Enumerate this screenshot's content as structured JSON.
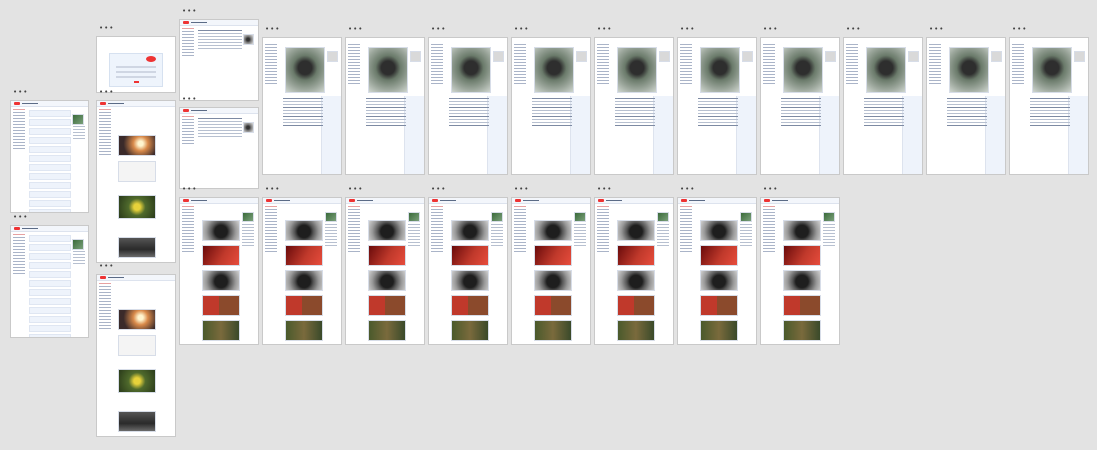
{
  "canvas": {
    "background": "#e3e3e3"
  },
  "frames": [
    {
      "id": "frame-home-1",
      "kind": "home-list",
      "menu_icon": "more-horizontal-icon"
    },
    {
      "id": "frame-home-2",
      "kind": "home-list",
      "menu_icon": "more-horizontal-icon"
    },
    {
      "id": "frame-login",
      "kind": "login",
      "menu_icon": "more-horizontal-icon"
    },
    {
      "id": "frame-feed-1",
      "kind": "image-feed",
      "menu_icon": "more-horizontal-icon"
    },
    {
      "id": "frame-feed-2",
      "kind": "image-feed",
      "menu_icon": "more-horizontal-icon"
    },
    {
      "id": "frame-submit-1",
      "kind": "submit-form",
      "menu_icon": "more-horizontal-icon"
    },
    {
      "id": "frame-submit-2",
      "kind": "submit-form",
      "menu_icon": "more-horizontal-icon"
    },
    {
      "id": "frame-post-1",
      "kind": "post-detail",
      "menu_icon": "more-horizontal-icon"
    },
    {
      "id": "frame-post-2",
      "kind": "post-detail",
      "menu_icon": "more-horizontal-icon"
    },
    {
      "id": "frame-post-3",
      "kind": "post-detail",
      "menu_icon": "more-horizontal-icon"
    },
    {
      "id": "frame-post-4",
      "kind": "post-detail",
      "menu_icon": "more-horizontal-icon"
    },
    {
      "id": "frame-post-5",
      "kind": "post-detail",
      "menu_icon": "more-horizontal-icon"
    },
    {
      "id": "frame-post-6",
      "kind": "post-detail",
      "menu_icon": "more-horizontal-icon"
    },
    {
      "id": "frame-post-7",
      "kind": "post-detail",
      "menu_icon": "more-horizontal-icon"
    },
    {
      "id": "frame-post-8",
      "kind": "post-detail",
      "menu_icon": "more-horizontal-icon"
    },
    {
      "id": "frame-post-9",
      "kind": "post-detail",
      "menu_icon": "more-horizontal-icon"
    },
    {
      "id": "frame-post-10",
      "kind": "post-detail",
      "menu_icon": "more-horizontal-icon"
    },
    {
      "id": "frame-gallery-1",
      "kind": "gallery",
      "menu_icon": "more-horizontal-icon"
    },
    {
      "id": "frame-gallery-2",
      "kind": "gallery",
      "menu_icon": "more-horizontal-icon"
    },
    {
      "id": "frame-gallery-3",
      "kind": "gallery",
      "menu_icon": "more-horizontal-icon"
    },
    {
      "id": "frame-gallery-4",
      "kind": "gallery",
      "menu_icon": "more-horizontal-icon"
    },
    {
      "id": "frame-gallery-5",
      "kind": "gallery",
      "menu_icon": "more-horizontal-icon"
    },
    {
      "id": "frame-gallery-6",
      "kind": "gallery",
      "menu_icon": "more-horizontal-icon"
    },
    {
      "id": "frame-gallery-7",
      "kind": "gallery",
      "menu_icon": "more-horizontal-icon"
    },
    {
      "id": "frame-gallery-8",
      "kind": "gallery",
      "menu_icon": "more-horizontal-icon"
    }
  ],
  "colors": {
    "brand_red": "#e33333",
    "panel_blue": "#eef3fb",
    "text_gray": "#7d8aa3"
  }
}
